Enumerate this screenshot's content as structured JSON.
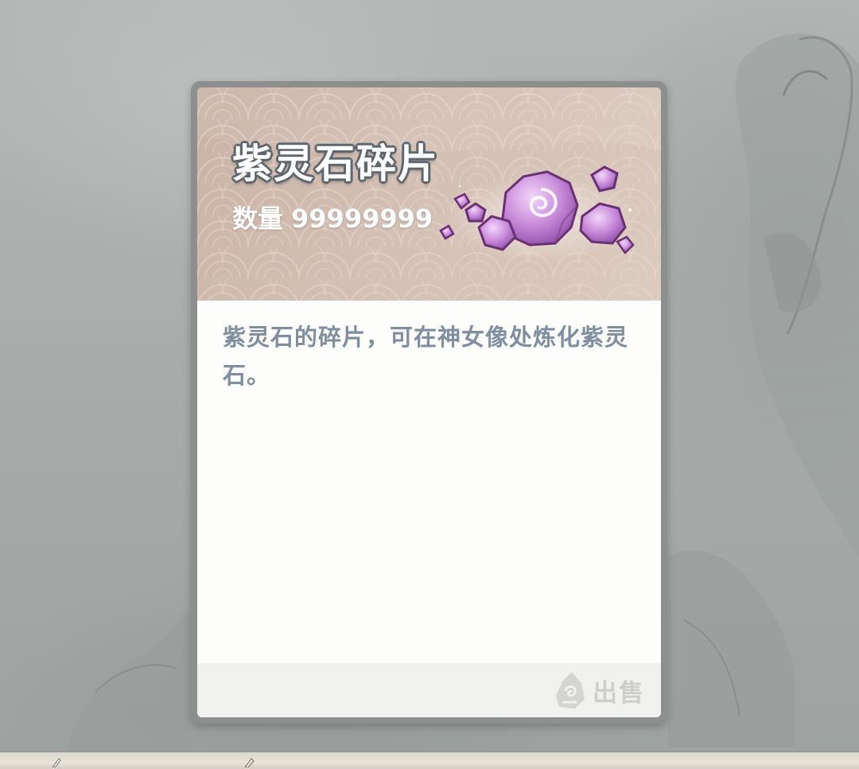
{
  "item": {
    "name": "紫灵石碎片",
    "quantity_label": "数量",
    "quantity_value": "99999999",
    "icon": "purple-spirit-stone-fragments-icon",
    "description": "紫灵石的碎片，可在神女像处炼化紫灵石。"
  },
  "actions": {
    "sell_label": "出售",
    "sell_icon": "coin-bag-icon"
  },
  "colors": {
    "header_bg": "#d3bfb3",
    "title_outline": "#5e6770",
    "description_text": "#7f8fa1",
    "sell_disabled": "#cdcdcb",
    "crystal": "#c48ad6"
  }
}
